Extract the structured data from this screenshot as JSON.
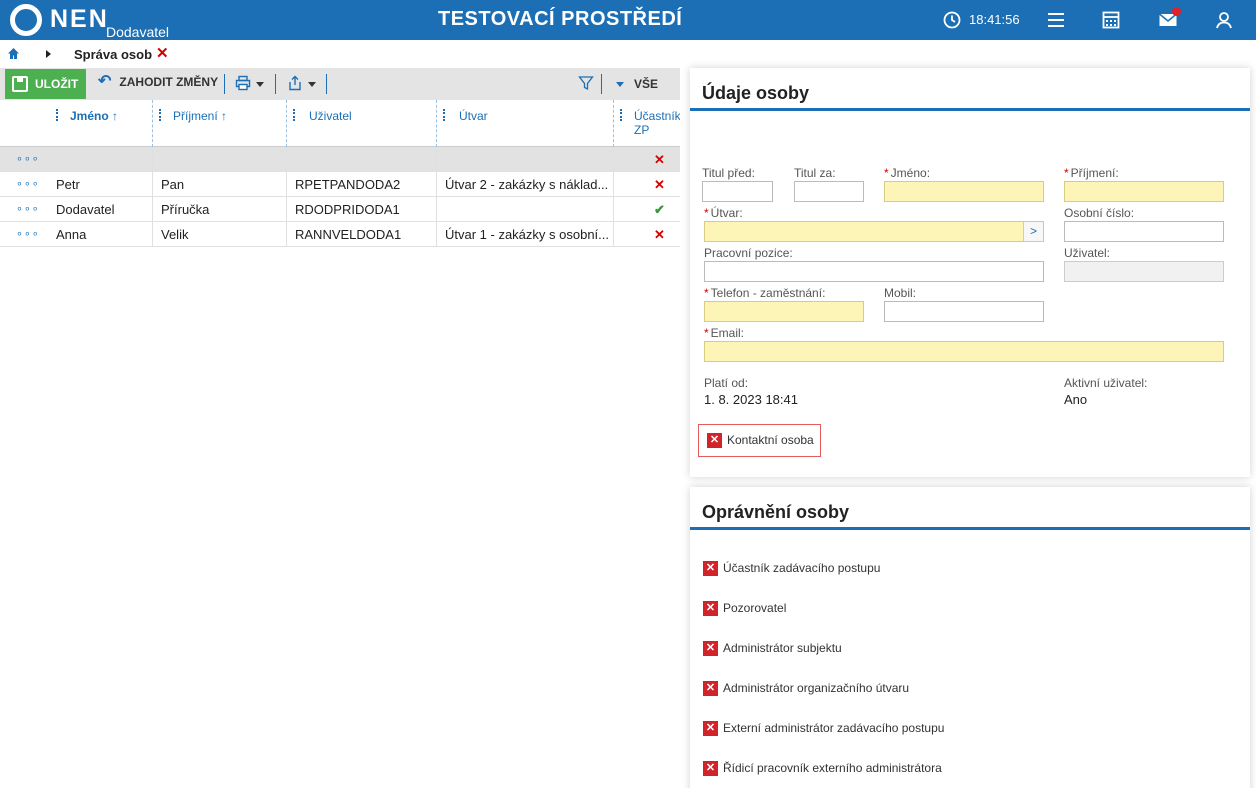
{
  "header": {
    "logo": "NEN",
    "logo_sub": "Dodavatel",
    "env_title": "TESTOVACÍ PROSTŘEDÍ",
    "time": "18:41:56",
    "icons": [
      "clock-icon",
      "menu-icon",
      "calculator-icon",
      "mail-icon",
      "user-icon"
    ],
    "colors": {
      "bar": "#1c6fb4",
      "notification": "#e0202a"
    }
  },
  "breadcrumb": {
    "label": "Správa osob",
    "close": "✕"
  },
  "toolbar": {
    "save_label": "ULOŽIT",
    "discard_label": "ZAHODIT ZMĚNY",
    "filter_label": "VŠE"
  },
  "grid": {
    "columns": [
      "Jméno ↑",
      "Příjmení ↑",
      "Uživatel",
      "Útvar",
      "Účastník ZP"
    ],
    "rows": [
      {
        "menu": "∘∘∘",
        "first": "",
        "last": "",
        "user": "",
        "unit": "",
        "zp": "✕"
      },
      {
        "menu": "∘∘∘",
        "first": "Petr",
        "last": "Pan",
        "user": "RPETPANDODA2",
        "unit": "Útvar 2 - zakázky s náklad...",
        "zp": "✕"
      },
      {
        "menu": "∘∘∘",
        "first": "Dodavatel",
        "last": "Příručka",
        "user": "RDODPRIDODA1",
        "unit": "",
        "zp": "✔"
      },
      {
        "menu": "∘∘∘",
        "first": "Anna",
        "last": "Velik",
        "user": "RANNVELDODA1",
        "unit": "Útvar 1 - zakázky s osobní...",
        "zp": "✕"
      }
    ]
  },
  "person": {
    "title": "Údaje osoby",
    "labels": {
      "titul_pred": "Titul před:",
      "titul_za": "Titul za:",
      "jmeno": "Jméno:",
      "prijmeni": "Příjmení:",
      "utvar": "Útvar:",
      "osobni_cislo": "Osobní číslo:",
      "pracovni_pozice": "Pracovní pozice:",
      "uzivatel": "Uživatel:",
      "telefon": "Telefon - zaměstnání:",
      "mobil": "Mobil:",
      "email": "Email:",
      "plati_od": "Platí od:",
      "aktivni": "Aktivní uživatel:"
    },
    "values": {
      "plati_od": "1. 8. 2023 18:41",
      "aktivni": "Ano"
    },
    "required_mark": "*",
    "utvar_button": ">",
    "kontakt": "Kontaktní osoba",
    "checkbox_mark": "✕"
  },
  "permissions": {
    "title": "Oprávnění osoby",
    "items": [
      "Účastník zadávacího postupu",
      "Pozorovatel",
      "Administrátor subjektu",
      "Administrátor organizačního útvaru",
      "Externí administrátor zadávacího postupu",
      "Řídicí pracovník externího administrátora"
    ]
  }
}
